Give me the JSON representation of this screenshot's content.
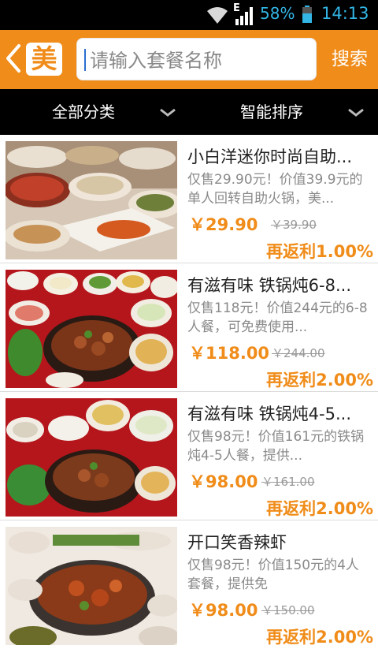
{
  "status_bar": {
    "network_label": "E",
    "battery_percent": "58%",
    "time": "14:13",
    "icons": [
      "wifi-icon",
      "signal-icon",
      "battery-icon"
    ],
    "accent_color": "#33b5e5"
  },
  "header": {
    "logo_char": "美",
    "search_placeholder": "请输入套餐名称",
    "search_button": "搜索",
    "brand_color": "#f08c19"
  },
  "filters": [
    {
      "label": "全部分类"
    },
    {
      "label": "智能排序"
    }
  ],
  "deals": [
    {
      "title": "小白洋迷你时尚自助...",
      "description": "仅售29.90元！价值39.9元的单人回转自助火锅，美...",
      "price": "￥29.90",
      "original_price": "￥39.90",
      "rebate": "再返利1.00%"
    },
    {
      "title": "有滋有味 铁锅炖6-8...",
      "description": "仅售118元！价值244元的6-8人餐，可免费使用...",
      "price": "￥118.00",
      "original_price": "￥244.00",
      "rebate": "再返利2.00%"
    },
    {
      "title": "有滋有味 铁锅炖4-5...",
      "description": "仅售98元！价值161元的铁锅炖4-5人餐，提供...",
      "price": "￥98.00",
      "original_price": "￥161.00",
      "rebate": "再返利2.00%"
    },
    {
      "title": "开口笑香辣虾",
      "description": "仅售98元！价值150元的4人套餐，提供免",
      "price": "￥98.00",
      "original_price": "￥150.00",
      "rebate": "再返利2.00%"
    }
  ]
}
